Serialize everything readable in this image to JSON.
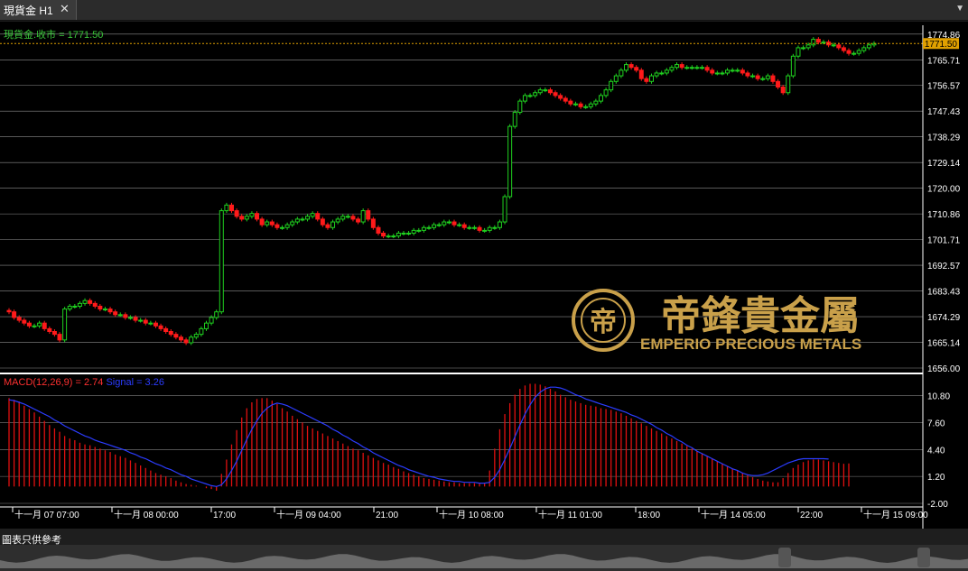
{
  "window": {
    "tab_label": "現貨金 H1",
    "close_glyph": "✕",
    "menu_glyph": "▼"
  },
  "price_panel": {
    "label": "現貨金.收市 = 1771.50",
    "current_price": "1771.50",
    "y_ticks": [
      "1774.86",
      "1765.71",
      "1756.57",
      "1747.43",
      "1738.29",
      "1729.14",
      "1720.00",
      "1710.86",
      "1701.71",
      "1692.57",
      "1683.43",
      "1674.29",
      "1665.14",
      "1656.00"
    ]
  },
  "macd_panel": {
    "name": "MACD(12,26,9) = 2.74",
    "signal": "Signal = 3.26",
    "y_ticks": [
      "10.80",
      "7.60",
      "4.40",
      "1.20",
      "-2.00"
    ]
  },
  "x_axis": {
    "labels": [
      "十一月 07 07:00",
      "十一月 08 00:00",
      "17:00",
      "十一月 09 04:00",
      "21:00",
      "十一月 10 08:00",
      "十一月 11 01:00",
      "18:00",
      "十一月 14 05:00",
      "22:00",
      "十一月 15 09:00"
    ]
  },
  "watermark": {
    "chinese": "帝鋒貴金屬",
    "english": "EMPERIO PRECIOUS METALS",
    "logo_glyph": "帝"
  },
  "footer": {
    "note": "圖表只供參考"
  },
  "colors": {
    "background": "#000000",
    "grid": "#ffffff",
    "up_candle": "#1fd01f",
    "down_candle": "#ff1a1a",
    "current_price_line": "#e0a000",
    "macd_histogram": "#e01010",
    "signal_line": "#2b3cff",
    "gold": "#c9a04a"
  },
  "chart_data": {
    "type": "candlestick",
    "symbol": "現貨金",
    "timeframe": "H1",
    "price_range": [
      1656.0,
      1778.0
    ],
    "macd_range": [
      -2.0,
      13.0
    ],
    "close": [
      1676,
      1674,
      1673,
      1672,
      1671,
      1671,
      1672,
      1670,
      1669,
      1668,
      1666,
      1677,
      1678,
      1678,
      1679,
      1680,
      1679,
      1678,
      1677,
      1677,
      1676,
      1675,
      1675,
      1674,
      1674,
      1673,
      1673,
      1672,
      1672,
      1671,
      1670,
      1669,
      1668,
      1667,
      1666,
      1665,
      1667,
      1668,
      1670,
      1672,
      1674,
      1676,
      1712,
      1714,
      1712,
      1710,
      1709,
      1710,
      1711,
      1709,
      1707,
      1708,
      1707,
      1706,
      1706,
      1707,
      1708,
      1709,
      1709,
      1710,
      1711,
      1709,
      1707,
      1706,
      1708,
      1709,
      1710,
      1710,
      1709,
      1708,
      1712,
      1709,
      1706,
      1704,
      1703,
      1703,
      1703,
      1704,
      1704,
      1704,
      1705,
      1705,
      1706,
      1706,
      1707,
      1707,
      1708,
      1708,
      1707,
      1707,
      1706,
      1706,
      1706,
      1705,
      1705,
      1706,
      1706,
      1708,
      1717,
      1742,
      1747,
      1751,
      1753,
      1753,
      1754,
      1755,
      1755,
      1754,
      1753,
      1752,
      1751,
      1750,
      1750,
      1749,
      1749,
      1750,
      1751,
      1753,
      1755,
      1758,
      1760,
      1762,
      1764,
      1763,
      1762,
      1759,
      1758,
      1760,
      1761,
      1761,
      1762,
      1763,
      1764,
      1763,
      1763,
      1763,
      1763,
      1763,
      1762,
      1761,
      1761,
      1761,
      1762,
      1762,
      1762,
      1761,
      1760,
      1760,
      1759,
      1759,
      1760,
      1758,
      1756,
      1754,
      1760,
      1767,
      1770,
      1770,
      1771,
      1773,
      1772,
      1772,
      1771,
      1771,
      1770,
      1769,
      1768,
      1768,
      1769,
      1770,
      1771,
      1771.5
    ],
    "macd": [
      10.5,
      10.3,
      10.1,
      9.6,
      9.2,
      8.8,
      8.3,
      7.8,
      7.3,
      6.9,
      6.5,
      6.0,
      5.7,
      5.5,
      5.2,
      5.0,
      4.9,
      4.7,
      4.5,
      4.3,
      4.1,
      3.8,
      3.6,
      3.4,
      3.1,
      2.8,
      2.5,
      2.2,
      1.9,
      1.6,
      1.4,
      1.2,
      1.0,
      0.7,
      0.5,
      0.3,
      0.2,
      0.1,
      0.0,
      -0.2,
      -0.3,
      -0.5,
      1.5,
      3.2,
      5.0,
      6.7,
      8.2,
      9.3,
      10.0,
      10.4,
      10.5,
      10.5,
      10.2,
      9.8,
      9.3,
      8.9,
      8.4,
      8.0,
      7.6,
      7.2,
      6.9,
      6.6,
      6.3,
      6.0,
      5.7,
      5.4,
      5.1,
      4.8,
      4.5,
      4.3,
      4.0,
      3.7,
      3.4,
      3.1,
      2.8,
      2.6,
      2.3,
      2.1,
      1.8,
      1.6,
      1.4,
      1.2,
      1.0,
      0.9,
      0.8,
      0.7,
      0.6,
      0.5,
      0.5,
      0.4,
      0.4,
      0.4,
      0.4,
      0.4,
      0.4,
      1.9,
      4.5,
      6.8,
      8.6,
      9.9,
      10.9,
      11.6,
      12.0,
      12.2,
      12.2,
      12.1,
      11.9,
      11.6,
      11.3,
      10.9,
      10.6,
      10.3,
      10.1,
      9.9,
      9.7,
      9.6,
      9.5,
      9.3,
      9.2,
      9.1,
      8.9,
      8.7,
      8.4,
      8.1,
      7.8,
      7.5,
      7.2,
      6.9,
      6.6,
      6.3,
      6.0,
      5.7,
      5.4,
      5.1,
      4.8,
      4.5,
      4.2,
      3.9,
      3.6,
      3.3,
      3.0,
      2.7,
      2.4,
      2.1,
      1.9,
      1.6,
      1.4,
      1.1,
      0.9,
      0.7,
      0.6,
      0.5,
      0.5,
      1.0,
      1.6,
      2.2,
      2.6,
      2.9,
      3.1,
      3.2,
      3.2,
      3.1,
      3.0,
      2.9,
      2.8,
      2.7,
      2.74
    ],
    "signal": [
      10.3,
      10.2,
      10.0,
      9.8,
      9.5,
      9.2,
      8.9,
      8.6,
      8.3,
      7.9,
      7.6,
      7.2,
      6.9,
      6.6,
      6.3,
      6.0,
      5.8,
      5.5,
      5.3,
      5.1,
      4.9,
      4.7,
      4.5,
      4.3,
      4.0,
      3.8,
      3.5,
      3.3,
      3.0,
      2.7,
      2.5,
      2.2,
      2.0,
      1.7,
      1.4,
      1.2,
      0.9,
      0.7,
      0.5,
      0.3,
      0.1,
      0.0,
      0.2,
      0.9,
      1.9,
      3.0,
      4.3,
      5.6,
      6.8,
      7.8,
      8.7,
      9.3,
      9.7,
      9.9,
      9.8,
      9.6,
      9.3,
      9.0,
      8.7,
      8.4,
      8.1,
      7.8,
      7.5,
      7.2,
      6.8,
      6.5,
      6.1,
      5.8,
      5.4,
      5.1,
      4.7,
      4.4,
      4.0,
      3.7,
      3.4,
      3.1,
      2.8,
      2.5,
      2.3,
      2.0,
      1.8,
      1.6,
      1.4,
      1.2,
      1.1,
      0.9,
      0.8,
      0.7,
      0.6,
      0.6,
      0.5,
      0.5,
      0.5,
      0.4,
      0.4,
      0.5,
      1.1,
      2.0,
      3.2,
      4.5,
      5.9,
      7.3,
      8.6,
      9.7,
      10.6,
      11.2,
      11.6,
      11.8,
      11.8,
      11.7,
      11.5,
      11.2,
      10.9,
      10.7,
      10.4,
      10.2,
      10.0,
      9.8,
      9.6,
      9.4,
      9.2,
      9.0,
      8.8,
      8.5,
      8.3,
      8.0,
      7.7,
      7.4,
      7.0,
      6.7,
      6.3,
      6.0,
      5.6,
      5.3,
      4.9,
      4.6,
      4.2,
      3.9,
      3.6,
      3.3,
      3.0,
      2.7,
      2.4,
      2.1,
      1.9,
      1.6,
      1.4,
      1.3,
      1.3,
      1.4,
      1.6,
      1.9,
      2.2,
      2.5,
      2.8,
      3.0,
      3.2,
      3.3,
      3.3,
      3.3,
      3.3,
      3.3,
      3.26
    ]
  }
}
